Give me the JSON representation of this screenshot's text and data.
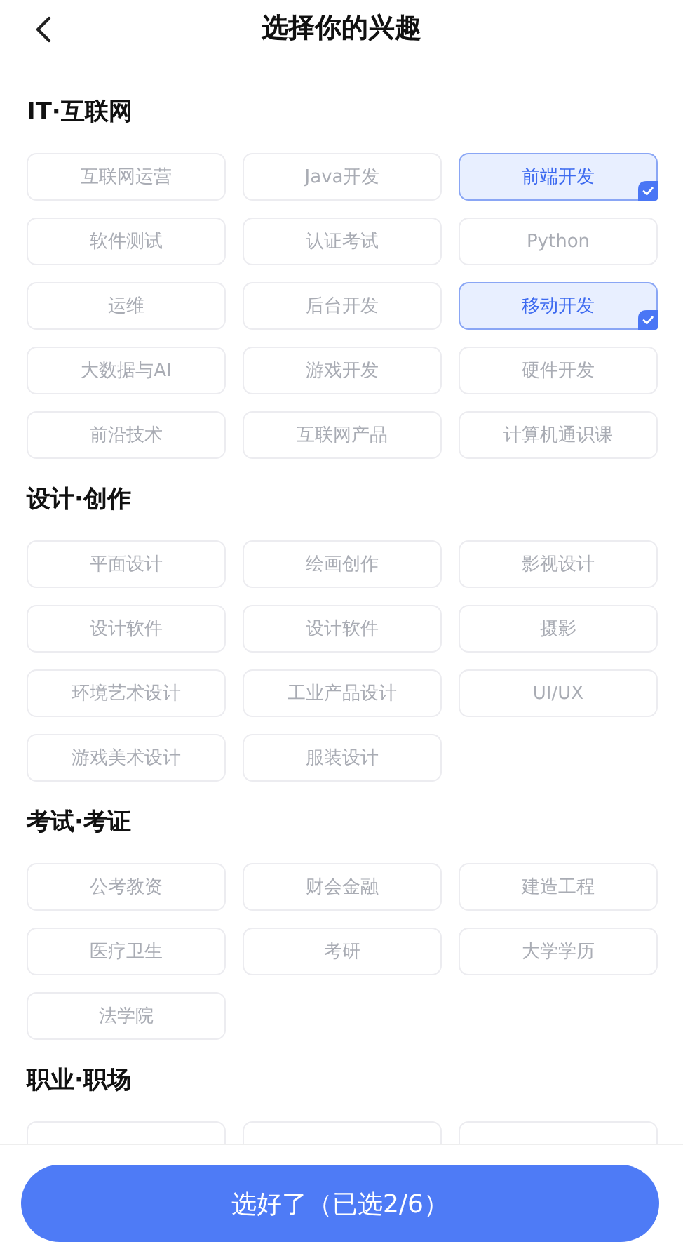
{
  "header": {
    "title": "选择你的兴趣"
  },
  "sections": [
    {
      "title": "IT·互联网",
      "chips": [
        {
          "label": "互联网运营",
          "selected": false
        },
        {
          "label": "Java开发",
          "selected": false
        },
        {
          "label": "前端开发",
          "selected": true
        },
        {
          "label": "软件测试",
          "selected": false
        },
        {
          "label": "认证考试",
          "selected": false
        },
        {
          "label": "Python",
          "selected": false
        },
        {
          "label": "运维",
          "selected": false
        },
        {
          "label": "后台开发",
          "selected": false
        },
        {
          "label": "移动开发",
          "selected": true
        },
        {
          "label": "大数据与AI",
          "selected": false
        },
        {
          "label": "游戏开发",
          "selected": false
        },
        {
          "label": "硬件开发",
          "selected": false
        },
        {
          "label": "前沿技术",
          "selected": false
        },
        {
          "label": "互联网产品",
          "selected": false
        },
        {
          "label": "计算机通识课",
          "selected": false
        }
      ]
    },
    {
      "title": "设计·创作",
      "chips": [
        {
          "label": "平面设计",
          "selected": false
        },
        {
          "label": "绘画创作",
          "selected": false
        },
        {
          "label": "影视设计",
          "selected": false
        },
        {
          "label": "设计软件",
          "selected": false
        },
        {
          "label": "设计软件",
          "selected": false
        },
        {
          "label": "摄影",
          "selected": false
        },
        {
          "label": "环境艺术设计",
          "selected": false
        },
        {
          "label": "工业产品设计",
          "selected": false
        },
        {
          "label": "UI/UX",
          "selected": false
        },
        {
          "label": "游戏美术设计",
          "selected": false
        },
        {
          "label": "服装设计",
          "selected": false
        }
      ]
    },
    {
      "title": "考试·考证",
      "chips": [
        {
          "label": "公考教资",
          "selected": false
        },
        {
          "label": "财会金融",
          "selected": false
        },
        {
          "label": "建造工程",
          "selected": false
        },
        {
          "label": "医疗卫生",
          "selected": false
        },
        {
          "label": "考研",
          "selected": false
        },
        {
          "label": "大学学历",
          "selected": false
        },
        {
          "label": "法学院",
          "selected": false
        }
      ]
    },
    {
      "title": "职业·职场",
      "chips": [
        {
          "selected": false
        },
        {
          "selected": false
        },
        {
          "selected": false
        }
      ]
    }
  ],
  "confirm_button": "选好了（已选2/6）"
}
